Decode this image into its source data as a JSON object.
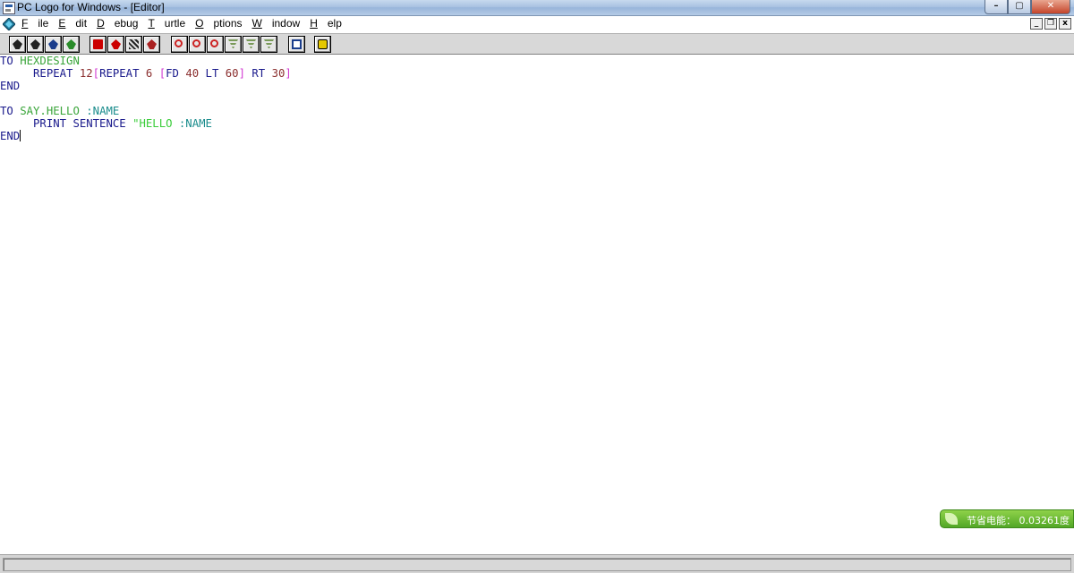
{
  "window": {
    "title": "PC Logo for Windows - [Editor]",
    "minimize_glyph": "–",
    "maximize_glyph": "▢",
    "close_glyph": "✕"
  },
  "menubar": {
    "items": [
      {
        "label": "File",
        "accel": "F",
        "rest": "ile"
      },
      {
        "label": "Edit",
        "accel": "E",
        "rest": "dit"
      },
      {
        "label": "Debug",
        "accel": "D",
        "rest": "ebug"
      },
      {
        "label": "Turtle",
        "accel": "T",
        "rest": "urtle"
      },
      {
        "label": "Options",
        "accel": "O",
        "rest": "ptions"
      },
      {
        "label": "Window",
        "accel": "W",
        "rest": "indow"
      },
      {
        "label": "Help",
        "accel": "H",
        "rest": "elp"
      }
    ],
    "mdi_buttons": [
      "_",
      "❐",
      "x"
    ]
  },
  "toolbar": {
    "buttons": [
      {
        "name": "turtle-open-icon",
        "color": "#222222"
      },
      {
        "name": "turtle-save-icon",
        "color": "#222222"
      },
      {
        "name": "print-icon",
        "color": "#1a3d8c"
      },
      {
        "name": "edit-icon",
        "color": "#2a8c2a"
      },
      {
        "name": "stop-icon",
        "color": "#cc0000"
      },
      {
        "name": "bug-icon",
        "color": "#cc0000"
      },
      {
        "name": "hatch-icon",
        "color": "#222222"
      },
      {
        "name": "step-icon",
        "color": "#aa2222"
      },
      {
        "name": "zoom-in-icon",
        "color": "#cc2222"
      },
      {
        "name": "zoom-red-icon",
        "color": "#cc2222"
      },
      {
        "name": "zoom-out-icon",
        "color": "#cc2222"
      },
      {
        "name": "speed-fast-icon",
        "color": "#7a9a5a"
      },
      {
        "name": "speed-medium-icon",
        "color": "#7a9a5a"
      },
      {
        "name": "speed-slow-icon",
        "color": "#7a9a5a"
      },
      {
        "name": "window-icon",
        "color": "#1a3d8c"
      },
      {
        "name": "help-icon",
        "color": "#e6c800"
      }
    ]
  },
  "editor": {
    "lines": [
      {
        "segments": [
          {
            "t": "TO ",
            "c": "kw"
          },
          {
            "t": "HEXDESIGN",
            "c": "pn"
          }
        ]
      },
      {
        "segments": [
          {
            "t": "     REPEAT ",
            "c": "kw"
          },
          {
            "t": "12",
            "c": "num"
          },
          {
            "t": "[",
            "c": "br"
          },
          {
            "t": "REPEAT ",
            "c": "kw"
          },
          {
            "t": "6 ",
            "c": "num"
          },
          {
            "t": "[",
            "c": "br"
          },
          {
            "t": "FD ",
            "c": "kw"
          },
          {
            "t": "40 ",
            "c": "num"
          },
          {
            "t": "LT ",
            "c": "kw"
          },
          {
            "t": "60",
            "c": "num"
          },
          {
            "t": "] ",
            "c": "br"
          },
          {
            "t": "RT ",
            "c": "kw"
          },
          {
            "t": "30",
            "c": "num"
          },
          {
            "t": "]",
            "c": "br"
          }
        ]
      },
      {
        "segments": [
          {
            "t": "END",
            "c": "kw"
          }
        ]
      },
      {
        "segments": []
      },
      {
        "segments": [
          {
            "t": "TO ",
            "c": "kw"
          },
          {
            "t": "SAY.HELLO ",
            "c": "pn"
          },
          {
            "t": ":NAME",
            "c": "var"
          }
        ]
      },
      {
        "segments": [
          {
            "t": "     PRINT ",
            "c": "kw"
          },
          {
            "t": "SENTENCE ",
            "c": "kw"
          },
          {
            "t": "\"HELLO ",
            "c": "str"
          },
          {
            "t": ":NAME",
            "c": "var"
          }
        ]
      },
      {
        "segments": [
          {
            "t": "END",
            "c": "kw"
          }
        ],
        "caret": true
      }
    ]
  },
  "badge": {
    "text": "节省电能： 0.03261度"
  },
  "status": {
    "text": ""
  }
}
